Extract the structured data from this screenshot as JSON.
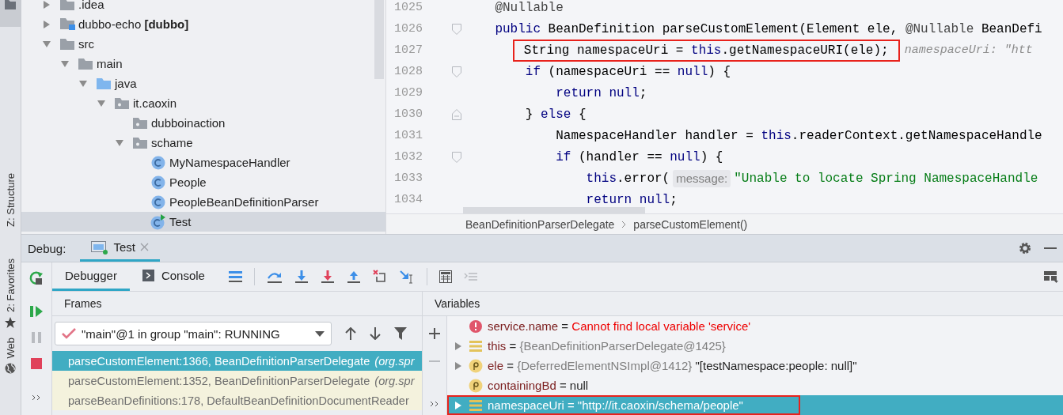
{
  "side_strip": {
    "items": [
      {
        "label": "Z: Structure"
      },
      {
        "label": "2: Favorites"
      },
      {
        "label": "Web"
      }
    ]
  },
  "project_tree": {
    "items": [
      {
        "label": ".idea",
        "kind": "folder",
        "expanded": false,
        "selected": false
      },
      {
        "label": "dubbo-echo **[dubbo]**",
        "kind": "module",
        "expanded": false,
        "selected": false
      },
      {
        "label": "src",
        "kind": "folder",
        "expanded": true,
        "selected": false,
        "children": [
          {
            "label": "main",
            "kind": "folder",
            "expanded": true,
            "selected": false,
            "children": [
              {
                "label": "java",
                "kind": "source_root",
                "expanded": true,
                "selected": false,
                "children": [
                  {
                    "label": "it.caoxin",
                    "kind": "package",
                    "expanded": true,
                    "selected": false,
                    "children": [
                      {
                        "label": "dubboinaction",
                        "kind": "package",
                        "selected": false
                      },
                      {
                        "label": "schame",
                        "kind": "package",
                        "expanded": true,
                        "selected": false,
                        "children": [
                          {
                            "label": "MyNamespaceHandler",
                            "kind": "class",
                            "selected": false
                          },
                          {
                            "label": "People",
                            "kind": "class",
                            "selected": false
                          },
                          {
                            "label": "PeopleBeanDefinitionParser",
                            "kind": "class",
                            "selected": false
                          },
                          {
                            "label": "Test",
                            "kind": "runnable_class",
                            "selected": true
                          }
                        ]
                      }
                    ]
                  }
                ]
              }
            ]
          }
        ]
      }
    ]
  },
  "editor": {
    "lines": [
      {
        "number": "1025",
        "kind": "plain",
        "segments": [
          {
            "kind": "code",
            "highlighted": false,
            "tokens": [
              {
                "kind": "annotation",
                "text": "    @Nullable"
              }
            ]
          }
        ]
      },
      {
        "number": "1026",
        "kind": "fold_start",
        "segments": [
          {
            "kind": "code",
            "highlighted": false,
            "tokens": [
              {
                "kind": "keyword",
                "text": "    public"
              },
              {
                "kind": "plain",
                "text": " BeanDefinition parseCustomElement(Element ele, "
              },
              {
                "kind": "annotation",
                "text": "@Nullable"
              },
              {
                "kind": "plain",
                "text": " BeanDefi"
              }
            ]
          }
        ]
      },
      {
        "number": "1027",
        "kind": "plain",
        "segments": [
          {
            "kind": "code",
            "highlighted": true,
            "tokens": [
              {
                "kind": "plain",
                "text": "        String namespaceUri = "
              },
              {
                "kind": "keyword",
                "text": "this"
              },
              {
                "kind": "plain",
                "text": ".getNamespaceURI(ele);"
              }
            ]
          },
          {
            "kind": "hint",
            "text": "namespaceUri: \"htt"
          }
        ]
      },
      {
        "number": "1028",
        "kind": "fold_start",
        "segments": [
          {
            "kind": "code",
            "highlighted": false,
            "tokens": [
              {
                "kind": "keyword",
                "text": "        if"
              },
              {
                "kind": "plain",
                "text": " (namespaceUri == "
              },
              {
                "kind": "keyword",
                "text": "null"
              },
              {
                "kind": "plain",
                "text": ") {"
              }
            ]
          }
        ]
      },
      {
        "number": "1029",
        "kind": "plain",
        "segments": [
          {
            "kind": "code",
            "highlighted": false,
            "tokens": [
              {
                "kind": "keyword",
                "text": "            return null"
              },
              {
                "kind": "plain",
                "text": ";"
              }
            ]
          }
        ]
      },
      {
        "number": "1030",
        "kind": "fold_end",
        "segments": [
          {
            "kind": "code",
            "highlighted": false,
            "tokens": [
              {
                "kind": "plain",
                "text": "        } "
              },
              {
                "kind": "keyword",
                "text": "else"
              },
              {
                "kind": "plain",
                "text": " {"
              }
            ]
          }
        ]
      },
      {
        "number": "1031",
        "kind": "plain",
        "segments": [
          {
            "kind": "code",
            "highlighted": false,
            "tokens": [
              {
                "kind": "plain",
                "text": "            NamespaceHandler handler = "
              },
              {
                "kind": "keyword",
                "text": "this"
              },
              {
                "kind": "plain",
                "text": ".readerContext.getNamespaceHandle"
              }
            ]
          }
        ]
      },
      {
        "number": "1032",
        "kind": "fold_start",
        "segments": [
          {
            "kind": "code",
            "highlighted": false,
            "tokens": [
              {
                "kind": "keyword",
                "text": "            if"
              },
              {
                "kind": "plain",
                "text": " (handler == "
              },
              {
                "kind": "keyword",
                "text": "null"
              },
              {
                "kind": "plain",
                "text": ") {"
              }
            ]
          }
        ]
      },
      {
        "number": "1033",
        "kind": "plain",
        "segments": [
          {
            "kind": "code",
            "highlighted": false,
            "tokens": [
              {
                "kind": "keyword",
                "text": "                this"
              },
              {
                "kind": "plain",
                "text": ".error("
              }
            ]
          },
          {
            "kind": "param",
            "text": "message:"
          },
          {
            "kind": "code",
            "highlighted": false,
            "tokens": [
              {
                "kind": "string",
                "text": "\"Unable to locate Spring NamespaceHandle"
              }
            ]
          }
        ]
      },
      {
        "number": "1034",
        "kind": "plain",
        "segments": [
          {
            "kind": "code",
            "highlighted": false,
            "tokens": [
              {
                "kind": "keyword",
                "text": "                return null"
              },
              {
                "kind": "plain",
                "text": ";"
              }
            ]
          }
        ]
      }
    ],
    "breadcrumbs": [
      "BeanDefinitionParserDelegate",
      "parseCustomElement()"
    ]
  },
  "debug": {
    "title": "Debug:",
    "session_tab": {
      "label": "Test",
      "selected": true
    },
    "tabs": [
      {
        "label": "Debugger",
        "kind": "debugger",
        "selected": true
      },
      {
        "label": "Console",
        "kind": "console",
        "selected": false
      }
    ],
    "frames": {
      "title": "Frames",
      "thread": "\"main\"@1 in group \"main\": RUNNING",
      "items": [
        {
          "label": "parseCustomElement:1366, BeanDefinitionParserDelegate *(org.spr*",
          "selected": true
        },
        {
          "label": "parseCustomElement:1352, BeanDefinitionParserDelegate *(org.spr*",
          "selected": false
        },
        {
          "label": "parseBeanDefinitions:178, DefaultBeanDefinitionDocumentReader",
          "selected": false
        }
      ]
    },
    "variables": {
      "title": "Variables",
      "items": [
        {
          "kind": "error",
          "expandable": false,
          "selected": false,
          "highlighted": false,
          "name": "service.name",
          "operator": "=",
          "value": {
            "kind": "error",
            "text": "Cannot find local variable 'service'"
          }
        },
        {
          "kind": "field",
          "expandable": true,
          "selected": false,
          "highlighted": false,
          "name": "this",
          "operator": "=",
          "value": {
            "kind": "reference",
            "text": "{BeanDefinitionParserDelegate@1425}"
          }
        },
        {
          "kind": "param",
          "expandable": true,
          "selected": false,
          "highlighted": false,
          "name": "ele",
          "operator": "=",
          "value": {
            "kind": "reference",
            "text": "{DeferredElementNSImpl@1412}"
          },
          "detail": "\"[testNamespace:people: null]\""
        },
        {
          "kind": "param",
          "expandable": false,
          "selected": false,
          "highlighted": false,
          "name": "containingBd",
          "operator": "=",
          "value": {
            "kind": "literal",
            "text": "null"
          }
        },
        {
          "kind": "field",
          "expandable": true,
          "selected": true,
          "highlighted": true,
          "name": "namespaceUri",
          "operator": "=",
          "value": {
            "kind": "literal",
            "text": "\"http://it.caoxin/schema/people\""
          }
        }
      ]
    }
  }
}
